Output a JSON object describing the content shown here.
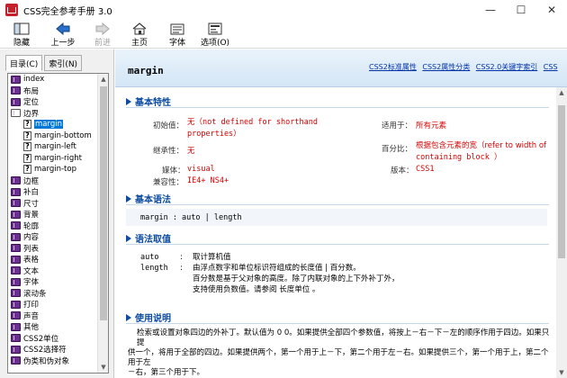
{
  "window": {
    "title": "CSS完全参考手册 3.0",
    "icon": "app-book-icon"
  },
  "window_controls": {
    "minimize": "—",
    "maximize": "☐",
    "close": "✕"
  },
  "toolbar": {
    "hide": "隐藏",
    "back": "上一步",
    "forward": "前进",
    "home": "主页",
    "font": "字体",
    "options": "选项(O)"
  },
  "sidebar": {
    "tabs": [
      {
        "label": "目录(C)"
      },
      {
        "label": "索引(N)"
      }
    ],
    "items": [
      {
        "label": "index"
      },
      {
        "label": "布局"
      },
      {
        "label": "定位"
      },
      {
        "label": "边界"
      },
      {
        "label": "margin"
      },
      {
        "label": "margin-bottom"
      },
      {
        "label": "margin-left"
      },
      {
        "label": "margin-right"
      },
      {
        "label": "margin-top"
      },
      {
        "label": "边框"
      },
      {
        "label": "补白"
      },
      {
        "label": "尺寸"
      },
      {
        "label": "背景"
      },
      {
        "label": "轮廓"
      },
      {
        "label": "内容"
      },
      {
        "label": "列表"
      },
      {
        "label": "表格"
      },
      {
        "label": "文本"
      },
      {
        "label": "字体"
      },
      {
        "label": "滚动条"
      },
      {
        "label": "打印"
      },
      {
        "label": "声音"
      },
      {
        "label": "其他"
      },
      {
        "label": "CSS2单位"
      },
      {
        "label": "CSS2选择符"
      },
      {
        "label": "伪类和伪对象"
      }
    ]
  },
  "content": {
    "property": "margin",
    "links": [
      "CSS2标准属性",
      "CSS2属性分类",
      "CSS2.0关键字索引",
      "CSS"
    ],
    "sections": {
      "basic": "基本特性",
      "syntax": "基本语法",
      "values": "语法取值",
      "usage": "使用说明"
    },
    "basic": {
      "initial_label": "初始值：",
      "initial_value_1": "无（not defined for shorthand",
      "initial_value_2": "properties）",
      "applies_label": "适用于：",
      "applies_value": "所有元素",
      "inherited_label": "继承性：",
      "inherited_value": "无",
      "percent_label": "百分比：",
      "percent_value_1": "根据包含元素的宽（refer to width of",
      "percent_value_2": "containing block ）",
      "media_label": "媒体：",
      "media_value": "visual",
      "version_label": "版本：",
      "version_value": "CSS1",
      "compat_label": "兼容性：",
      "compat_value": "IE4+ NS4+"
    },
    "syntax": "margin : auto | length",
    "values": {
      "auto_key": "auto",
      "auto_desc": "取计算机值",
      "length_key": "length",
      "length_desc_1": "由浮点数字和单位标识符组成的长度值 | 百分数。",
      "length_desc_2": "百分数是基于父对象的高度。除了内联对象的上下外补丁外，",
      "length_desc_3": "支持使用负数值。请参阅 长度单位 。",
      "colon": ":"
    },
    "usage_1": "检索或设置对象四边的外补丁。默认值为 0 0。如果提供全部四个参数值，将按上－右－下－左的顺序作用于四边。如果只提",
    "usage_2": "供一个，将用于全部的四边。如果提供两个，第一个用于上－下，第二个用于左－右。如果提供三个，第一个用于上，第二个用于左",
    "usage_3": "－右，第三个用于下。"
  }
}
